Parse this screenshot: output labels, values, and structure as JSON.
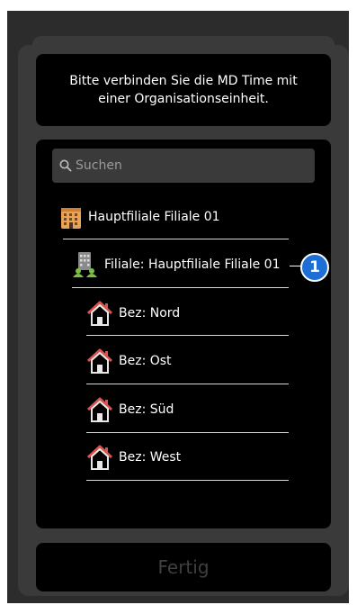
{
  "header": {
    "message": "Bitte verbinden Sie die MD Time mit einer Organisationseinheit."
  },
  "search": {
    "placeholder": "Suchen"
  },
  "tree": {
    "items": [
      {
        "label": "Hauptfiliale Filiale 01",
        "icon": "building-icon"
      },
      {
        "label": "Filiale: Hauptfiliale Filiale 01",
        "icon": "branch-building-icon"
      },
      {
        "label": "Bez: Nord",
        "icon": "house-icon"
      },
      {
        "label": "Bez: Ost",
        "icon": "house-icon"
      },
      {
        "label": "Bez: Süd",
        "icon": "house-icon"
      },
      {
        "label": "Bez: West",
        "icon": "house-icon"
      }
    ]
  },
  "footer": {
    "done_label": "Fertig"
  },
  "callout": {
    "number": "1",
    "color": "#1d6fd6"
  }
}
